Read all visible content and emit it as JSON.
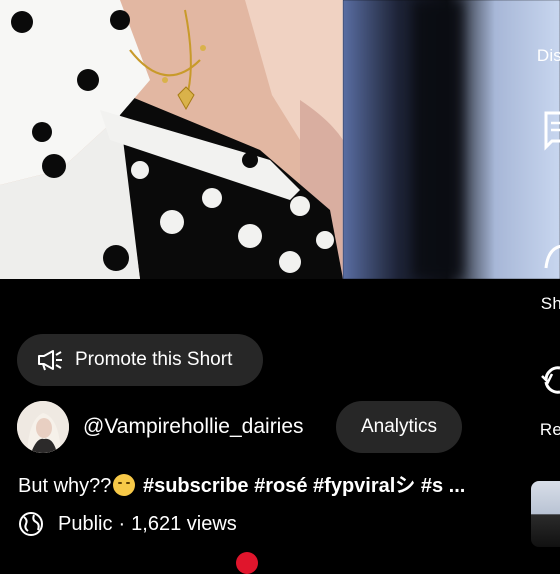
{
  "side_actions": {
    "dislike_label": "Dis",
    "share_label": "Sh",
    "remix_label": "Re"
  },
  "promote": {
    "label": "Promote this Short"
  },
  "channel": {
    "handle": "@Vampirehollie_dairies",
    "analytics_label": "Analytics"
  },
  "description": {
    "prefix": "But why??",
    "emoji": "crying-face-emoji",
    "tags": "#subscribe #rosé #fypviralシ #s ..."
  },
  "meta": {
    "visibility": "Public",
    "separator": "·",
    "views": "1,621 views"
  },
  "colors": {
    "background": "#000000",
    "pill": "#272727",
    "accent_red": "#e0152c"
  }
}
